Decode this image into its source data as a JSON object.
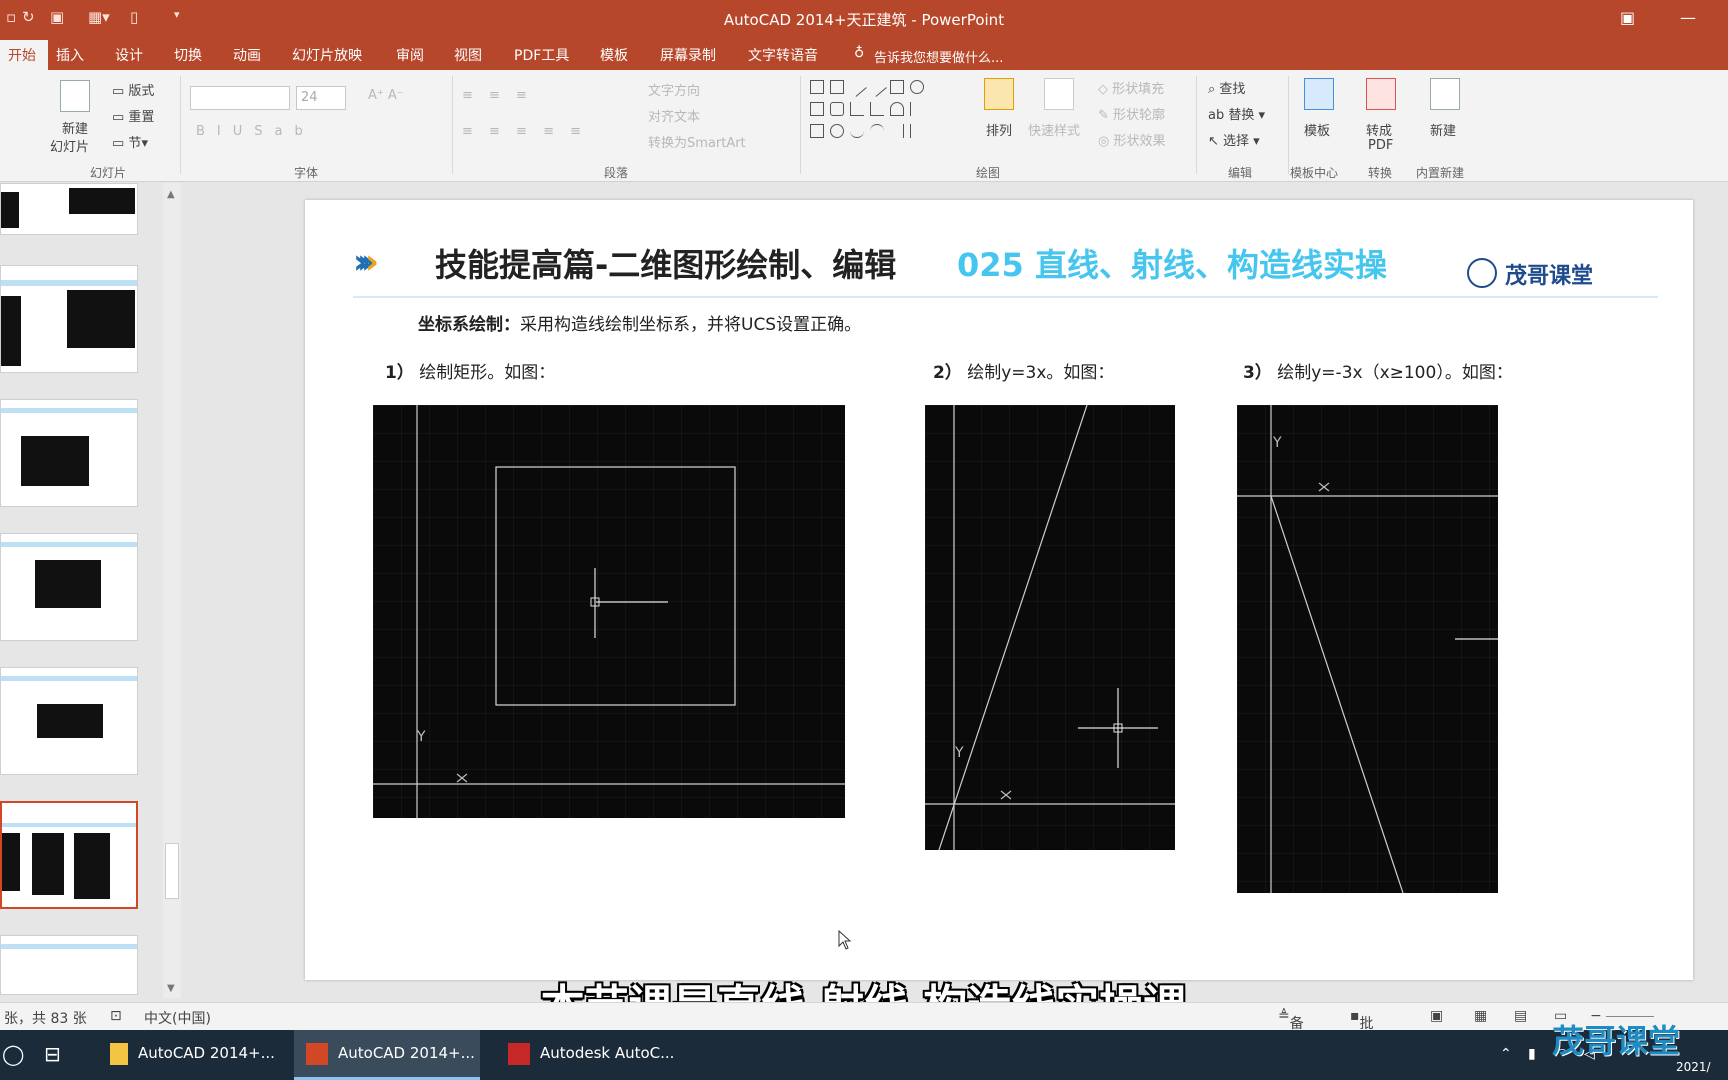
{
  "window": {
    "title": "AutoCAD 2014+天正建筑 - PowerPoint"
  },
  "ribbon": {
    "tabs": [
      "开始",
      "插入",
      "设计",
      "切换",
      "动画",
      "幻灯片放映",
      "审阅",
      "视图",
      "PDF工具",
      "模板",
      "屏幕录制",
      "文字转语音"
    ],
    "tell_me": "告诉我您想要做什么...",
    "slides_group": {
      "new_slide": "新建",
      "new_slide_2": "幻灯片",
      "layout": "版式",
      "reset": "重置",
      "section": "节",
      "label": "幻灯片"
    },
    "font_group": {
      "size": "24",
      "label": "字体"
    },
    "paragraph_group": {
      "text_direction": "文字方向",
      "align_text": "对齐文本",
      "smartart": "转换为SmartArt",
      "label": "段落"
    },
    "drawing_group": {
      "arrange": "排列",
      "quick_styles": "快速样式",
      "shape_fill": "形状填充",
      "shape_outline": "形状轮廓",
      "shape_effects": "形状效果",
      "label": "绘图"
    },
    "editing_group": {
      "find": "查找",
      "replace": "替换",
      "select": "选择",
      "label": "编辑"
    },
    "template": {
      "label": "模板",
      "group": "模板中心"
    },
    "pdf": {
      "label": "转成",
      "label2": "PDF",
      "group": "转换"
    },
    "new": {
      "label": "新建",
      "group": "内置新建"
    }
  },
  "slide": {
    "heading_main": "技能提高篇-二维图形绘制、编辑",
    "heading_sub": "025 直线、射线、构造线实操",
    "brand": "茂哥课堂",
    "task_label": "坐标系绘制：",
    "task_text": "采用构造线绘制坐标系，并将UCS设置正确。",
    "steps": [
      {
        "num": "1）",
        "text": "绘制矩形。如图："
      },
      {
        "num": "2）",
        "text": "绘制y=3x。如图："
      },
      {
        "num": "3）",
        "text": "绘制y=-3x（x≥100）。如图："
      }
    ],
    "axis_y": "Y"
  },
  "subtitle": "本节课是直线 射线 构造线实操课",
  "status": {
    "slide_count": "张，共 83 张",
    "language": "中文(中国)",
    "notes": "备注",
    "comments": "批注"
  },
  "taskbar": {
    "items": [
      "AutoCAD 2014+...",
      "AutoCAD 2014+...",
      "Autodesk AutoC..."
    ],
    "date": "2021/",
    "watermark": "茂哥课堂"
  },
  "colors": {
    "accent": "#b7472a",
    "heading_blue": "#46c6ef",
    "cad_bg": "#0a0a0a"
  }
}
